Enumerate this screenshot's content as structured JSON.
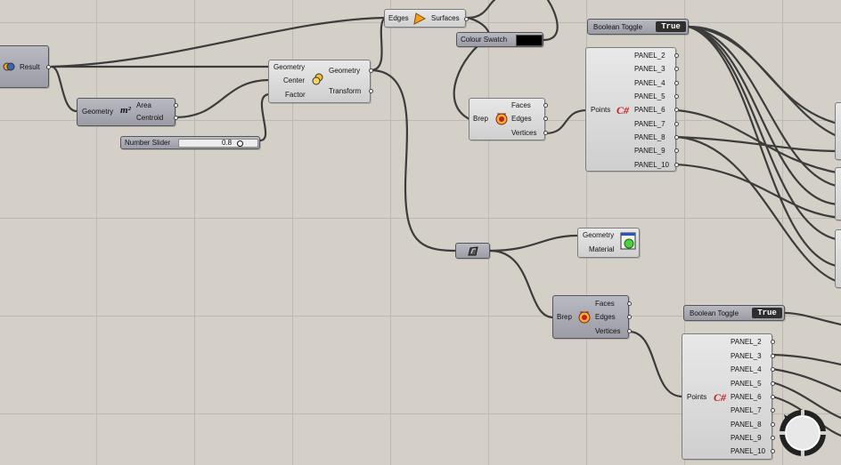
{
  "panel_names": [
    "PANEL_2",
    "PANEL_3",
    "PANEL_4",
    "PANEL_5",
    "PANEL_6",
    "PANEL_7",
    "PANEL_8",
    "PANEL_9",
    "PANEL_10"
  ],
  "result_node": {
    "label": "Result"
  },
  "area_node": {
    "input": "Geometry",
    "outputs": [
      "Area",
      "Centroid"
    ]
  },
  "slider_node": {
    "label": "Number Slider",
    "value": "0.8"
  },
  "scale_node": {
    "inputs": [
      "Geometry",
      "Center",
      "Factor"
    ],
    "outputs": [
      "Geometry",
      "Transform"
    ]
  },
  "boundary_node": {
    "input": "Edges",
    "output": "Surfaces"
  },
  "swatch_node": {
    "label": "Colour Swatch",
    "color": "#000000"
  },
  "deconstruct_top": {
    "input": "Brep",
    "outputs": [
      "Faces",
      "Edges",
      "Vertices"
    ]
  },
  "deconstruct_bottom": {
    "input": "Brep",
    "outputs": [
      "Faces",
      "Edges",
      "Vertices"
    ]
  },
  "csharp_top": {
    "input": "Points"
  },
  "csharp_bottom": {
    "input": "Points"
  },
  "toggle_top": {
    "label": "Boolean Toggle",
    "value": "True"
  },
  "toggle_bottom": {
    "label": "Boolean Toggle",
    "value": "True"
  },
  "preview_node": {
    "inputs": [
      "Geometry",
      "Material"
    ]
  },
  "icons": [
    "result-icon",
    "area-m2-icon",
    "scale-icon",
    "boundary-surface-icon",
    "deconstruct-brep-icon",
    "csharp-icon",
    "preview-material-icon",
    "relay-icon",
    "navigation-compass-icon"
  ],
  "colors": {
    "canvas": "#d4d0c8",
    "wire": "#3c3c3c",
    "component": "#d6d6d6",
    "param_dark": "#a3a3ad",
    "toggle": "#2f2f2f",
    "csharp": "#c21f1f"
  }
}
